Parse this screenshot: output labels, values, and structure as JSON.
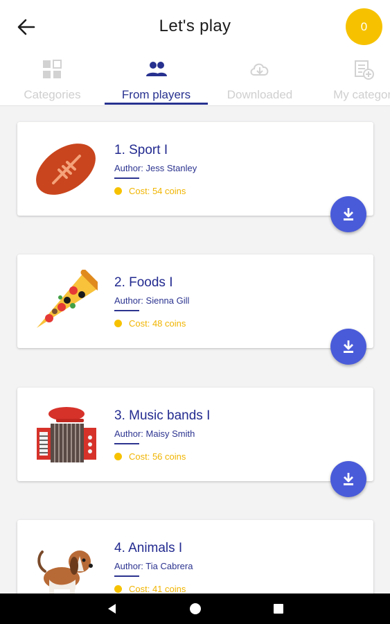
{
  "app_bar": {
    "title": "Let's play",
    "coins": "0",
    "back_icon": "arrow-left-icon"
  },
  "tabs": [
    {
      "label": "Categories",
      "icon": "grid-icon",
      "active": false
    },
    {
      "label": "From players",
      "icon": "people-icon",
      "active": true
    },
    {
      "label": "Downloaded",
      "icon": "cloud-download-icon",
      "active": false
    },
    {
      "label": "My categori",
      "icon": "add-document-icon",
      "active": false
    }
  ],
  "cards": [
    {
      "title": "1. Sport I",
      "author": "Author: Jess Stanley",
      "cost": "Cost: 54 coins",
      "image": "football-icon"
    },
    {
      "title": "2. Foods I",
      "author": "Author: Sienna Gill",
      "cost": "Cost: 48 coins",
      "image": "pizza-icon"
    },
    {
      "title": "3. Music bands I",
      "author": "Author: Maisy Smith",
      "cost": "Cost: 56 coins",
      "image": "accordion-icon"
    },
    {
      "title": "4. Animals I",
      "author": "Author: Tia Cabrera",
      "cost": "Cost: 41 coins",
      "image": "dog-icon"
    }
  ],
  "colors": {
    "accent": "#27318f",
    "coin": "#f6c200",
    "download_button": "#4a5bd9"
  },
  "nav_bar": {
    "back_icon": "nav-back-icon",
    "home_icon": "nav-home-icon",
    "recents_icon": "nav-recents-icon"
  }
}
